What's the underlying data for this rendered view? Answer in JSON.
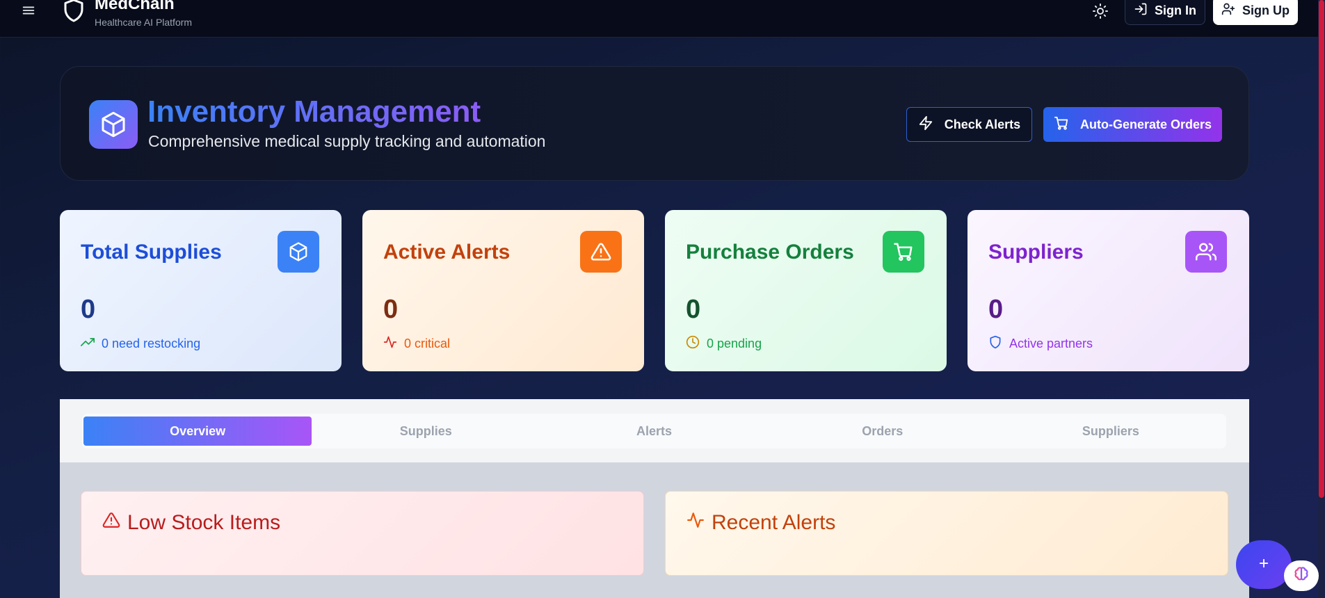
{
  "topbar": {
    "menu_icon": "hamburger-icon",
    "brand_name": "MedChain",
    "brand_subtitle": "Healthcare AI Platform",
    "theme_icon": "sun-icon",
    "sign_in_label": "Sign In",
    "sign_up_label": "Sign Up"
  },
  "header": {
    "title": "Inventory Management",
    "subtitle": "Comprehensive medical supply tracking and automation",
    "check_alerts_label": "Check Alerts",
    "auto_generate_label": "Auto-Generate Orders"
  },
  "stats": [
    {
      "title": "Total Supplies",
      "value": "0",
      "footnote": "0 need restocking",
      "icon": "box-icon",
      "foot_icon": "trending-up-icon"
    },
    {
      "title": "Active Alerts",
      "value": "0",
      "footnote": "0 critical",
      "icon": "alert-triangle-icon",
      "foot_icon": "activity-icon"
    },
    {
      "title": "Purchase Orders",
      "value": "0",
      "footnote": "0 pending",
      "icon": "cart-icon",
      "foot_icon": "clock-icon"
    },
    {
      "title": "Suppliers",
      "value": "0",
      "footnote": "Active partners",
      "icon": "users-icon",
      "foot_icon": "shield-icon"
    }
  ],
  "tabs": [
    {
      "label": "Overview",
      "active": true
    },
    {
      "label": "Supplies",
      "active": false
    },
    {
      "label": "Alerts",
      "active": false
    },
    {
      "label": "Orders",
      "active": false
    },
    {
      "label": "Suppliers",
      "active": false
    }
  ],
  "panels": {
    "low_stock_title": "Low Stock Items",
    "recent_alerts_title": "Recent Alerts"
  },
  "colors": {
    "accent_blue": "#3b82f6",
    "accent_purple": "#8b5cf6",
    "orange": "#f97316",
    "green": "#22c55e",
    "violet": "#a855f7"
  }
}
